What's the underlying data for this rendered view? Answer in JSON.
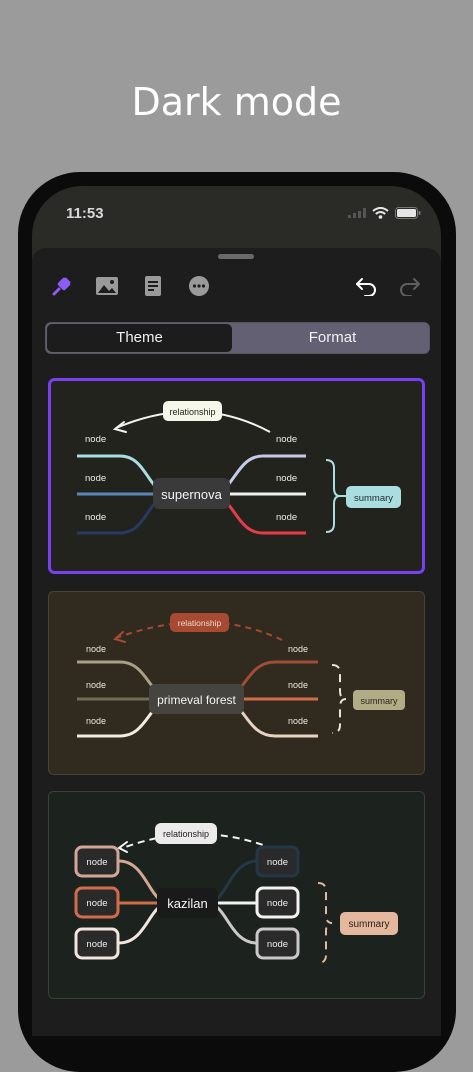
{
  "headline": "Dark mode",
  "status_bar": {
    "time": "11:53"
  },
  "toolbar": {
    "icons": [
      "style-brush-icon",
      "image-icon",
      "document-icon",
      "more-icon",
      "undo-icon",
      "redo-icon"
    ]
  },
  "segment": {
    "tabs": [
      "Theme",
      "Format"
    ],
    "selected": "Theme"
  },
  "themes": [
    {
      "name": "supernova",
      "relationship": "relationship",
      "summary": "summary",
      "nodes": [
        "node",
        "node",
        "node",
        "node",
        "node",
        "node"
      ],
      "selected": true
    },
    {
      "name": "primeval forest",
      "relationship": "relationship",
      "summary": "summary",
      "nodes": [
        "node",
        "node",
        "node",
        "node",
        "node",
        "node"
      ],
      "selected": false
    },
    {
      "name": "kazilan",
      "relationship": "relationship",
      "summary": "summary",
      "nodes": [
        "node",
        "node",
        "node",
        "node",
        "node",
        "node"
      ],
      "selected": false
    }
  ],
  "colors": {
    "accent": "#7b3ff2",
    "card1_bg": "#23231e",
    "card2_bg": "#312a1f",
    "card3_bg": "#1c221d"
  }
}
